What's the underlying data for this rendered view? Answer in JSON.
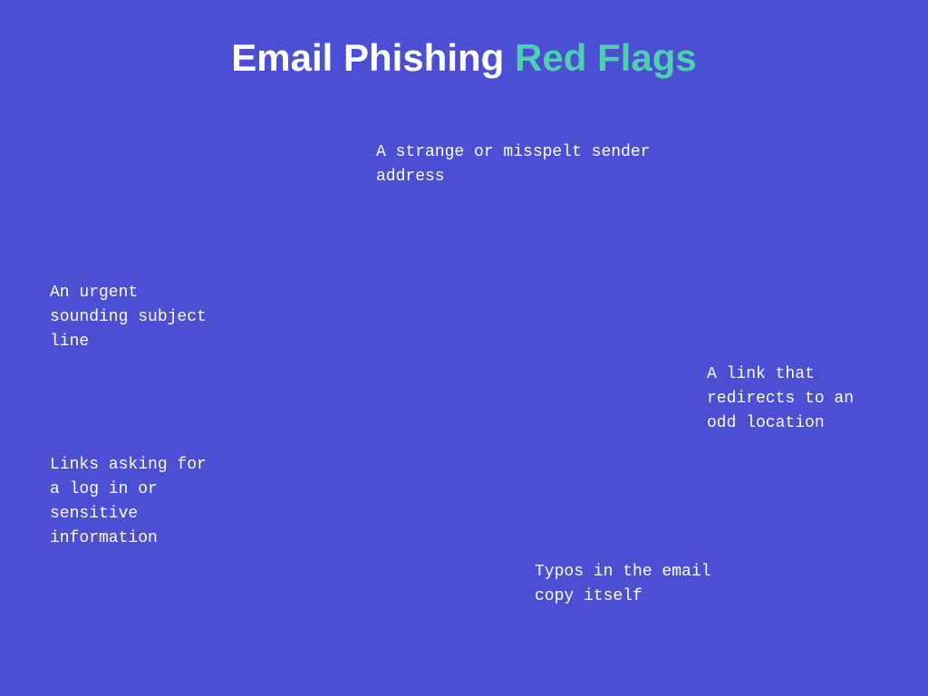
{
  "background_color": "#4a4fd4",
  "title": {
    "part1": "Email Phishing ",
    "part2": "Red Flags"
  },
  "flags": {
    "sender": {
      "text": "A strange or misspelt sender\naddress"
    },
    "urgent": {
      "text": "An urgent\nsounding subject\nline"
    },
    "link": {
      "text": "A link that\nredirects to an\nodd location"
    },
    "login": {
      "text": "Links asking for\na log in or\nsensitive\ninformation"
    },
    "typos": {
      "text": "Typos in the email\ncopy itself"
    }
  }
}
